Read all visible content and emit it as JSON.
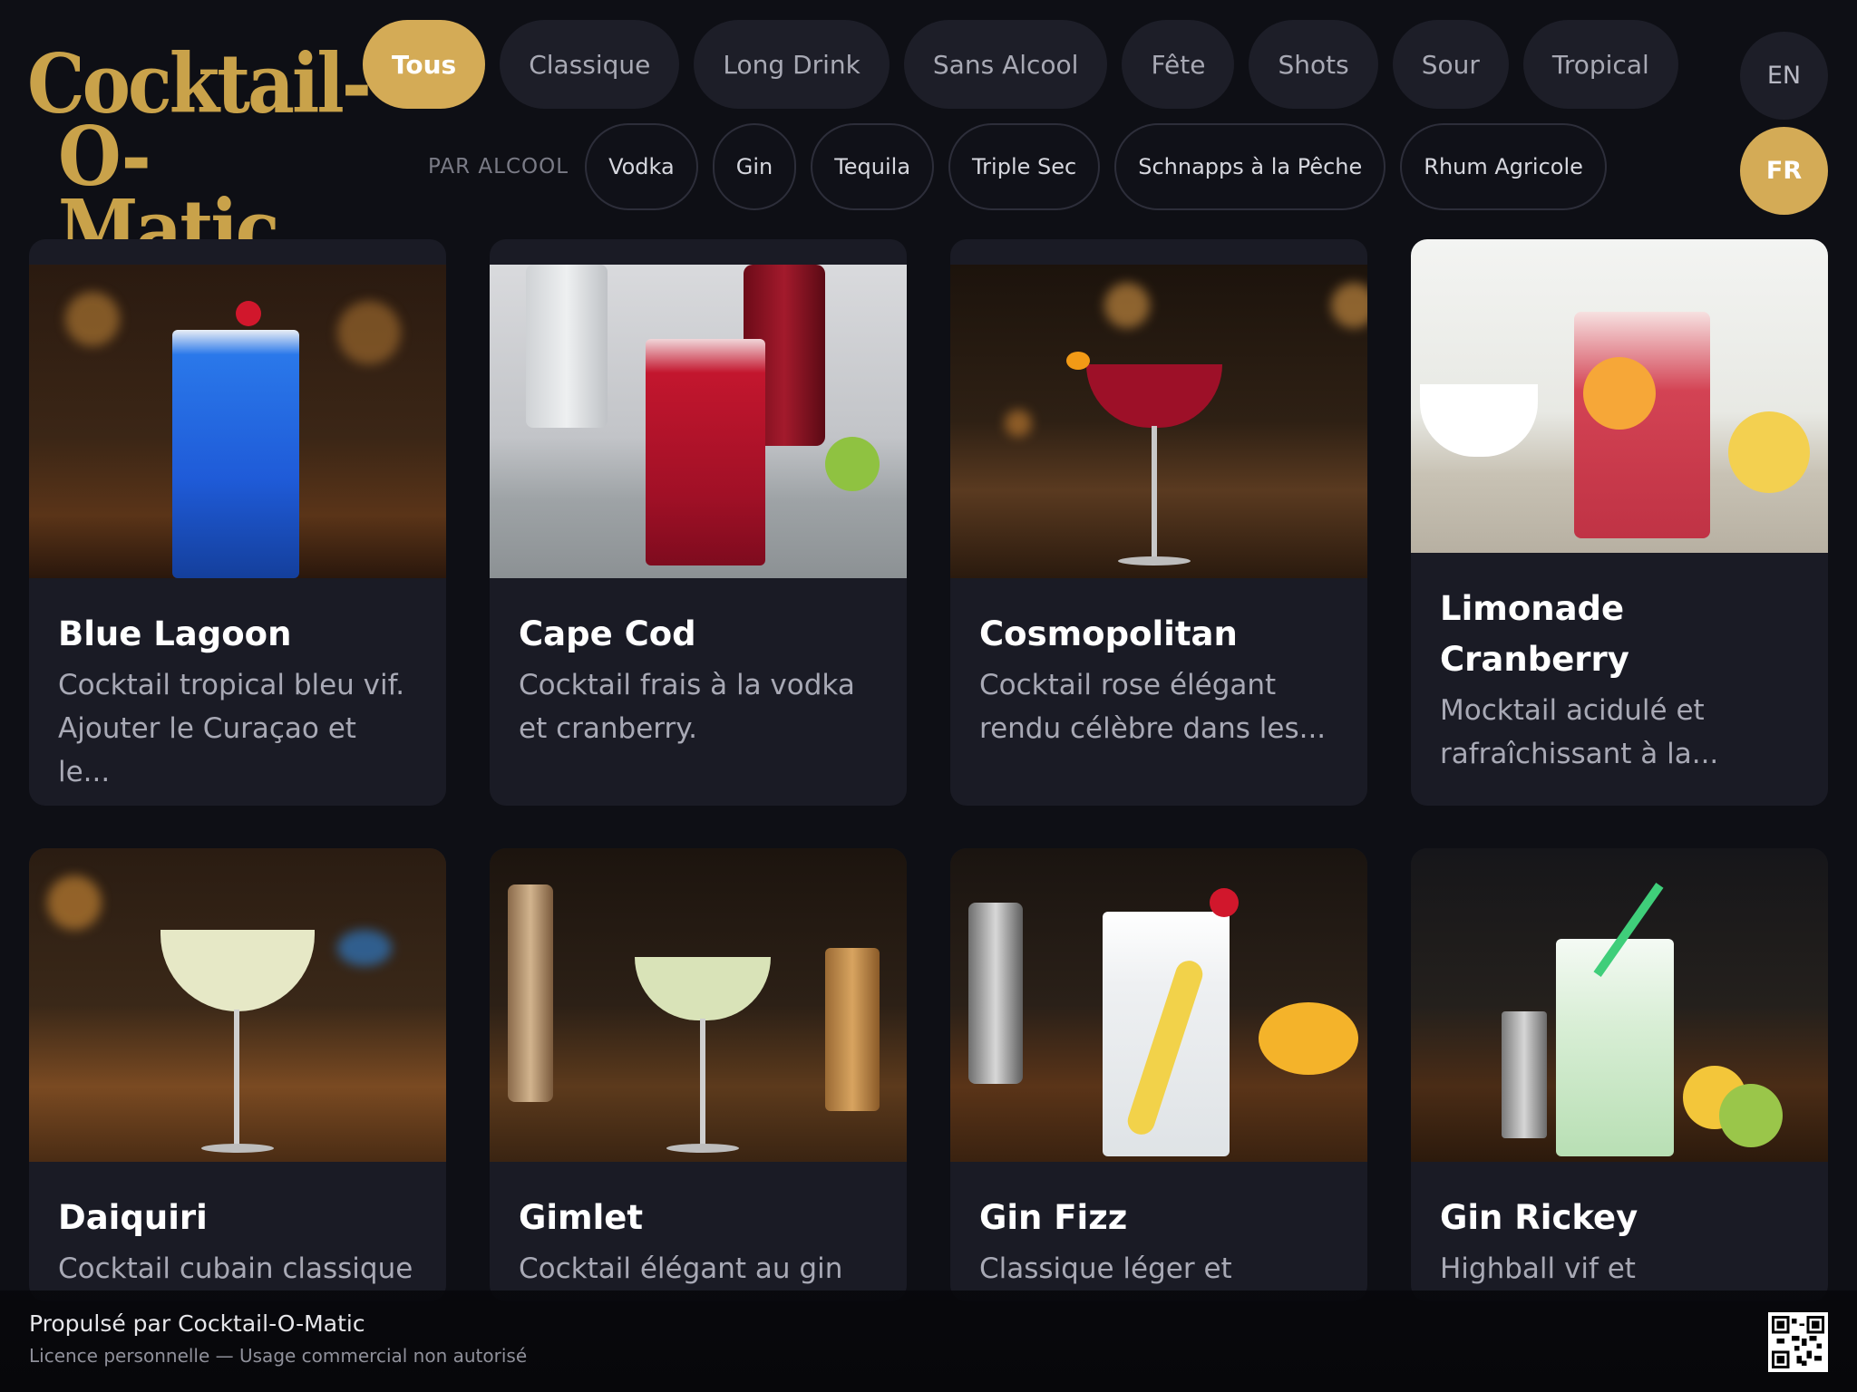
{
  "brand": {
    "line1": "Cocktail-",
    "line2": "O-Matic",
    "color": "#c9a24a"
  },
  "categories": [
    "Tous",
    "Classique",
    "Long Drink",
    "Sans Alcool",
    "Fête",
    "Shots",
    "Sour",
    "Tropical"
  ],
  "active_category": "Tous",
  "alcohol_filter": {
    "label": "PAR ALCOOL",
    "options": [
      "Vodka",
      "Gin",
      "Tequila",
      "Triple Sec",
      "Schnapps à la Pêche",
      "Rhum Agricole"
    ]
  },
  "languages": {
    "en": "EN",
    "fr": "FR",
    "active": "FR"
  },
  "cocktails": [
    {
      "name": "Blue Lagoon",
      "desc1": "Cocktail tropical bleu vif.",
      "desc2": "Ajouter le Curaçao et le...",
      "drink_color": "#1f5bd8"
    },
    {
      "name": "Cape Cod",
      "desc1": "Cocktail frais à la vodka",
      "desc2": "et cranberry.",
      "drink_color": "#b3132c"
    },
    {
      "name": "Cosmopolitan",
      "desc1": "Cocktail rose élégant",
      "desc2": "rendu célèbre dans les...",
      "drink_color": "#9d1028"
    },
    {
      "name1": "Limonade",
      "name2": "Cranberry",
      "desc1": "Mocktail acidulé et",
      "desc2": "rafraîchissant à la...",
      "drink_color": "#d23a4c"
    },
    {
      "name": "Daiquiri",
      "desc1": "Cocktail cubain classique",
      "drink_color": "#e6e8c6"
    },
    {
      "name": "Gimlet",
      "desc1": "Cocktail élégant au gin et",
      "drink_color": "#d9e3b8"
    },
    {
      "name": "Gin Fizz",
      "desc1": "Classique léger et",
      "drink_color": "#eef0f2"
    },
    {
      "name": "Gin Rickey",
      "desc1": "Highball vif et",
      "drink_color": "#d8eed5"
    }
  ],
  "footer": {
    "powered": "Propulsé par Cocktail-O-Matic",
    "license": "Licence personnelle — Usage commercial non autorisé"
  },
  "colors": {
    "accent": "#d4ab56",
    "background": "#0e0f15",
    "card": "#1a1b25"
  }
}
